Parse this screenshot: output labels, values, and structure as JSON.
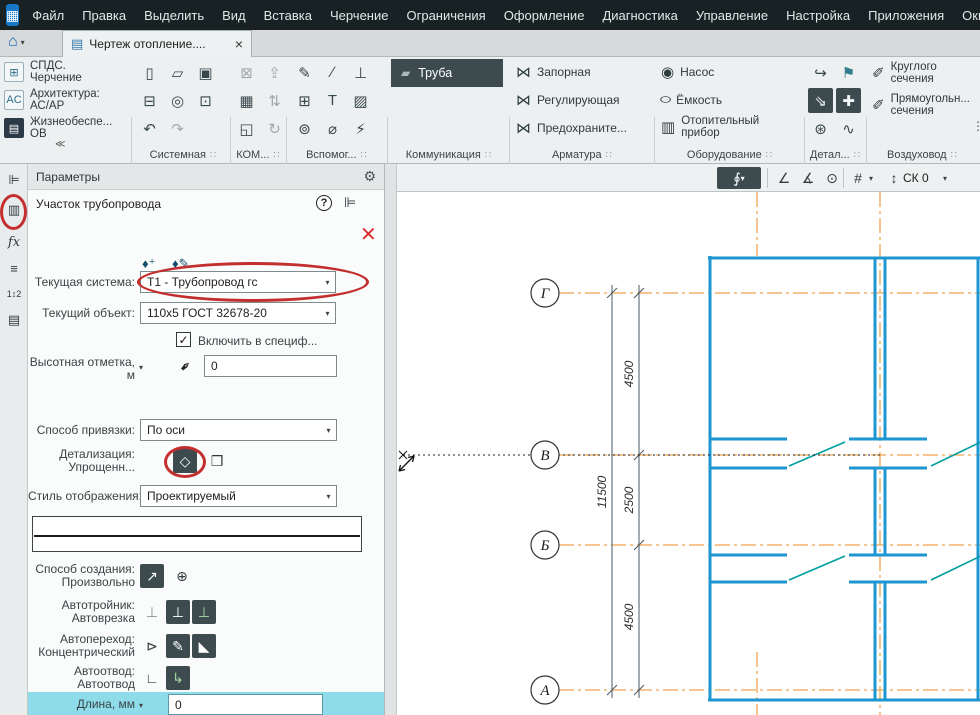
{
  "menubar": {
    "items": [
      "Файл",
      "Правка",
      "Выделить",
      "Вид",
      "Вставка",
      "Черчение",
      "Ограничения",
      "Оформление",
      "Диагностика",
      "Управление",
      "Настройка",
      "Приложения",
      "Окн"
    ]
  },
  "tabbar": {
    "active_tab": "Чертеж отопление...."
  },
  "workspaces": [
    {
      "line1": "СПДС.",
      "line2": "Черчение",
      "icon": "⊞"
    },
    {
      "line1": "Архитектура:",
      "line2": "АС/АР",
      "icon": "AC"
    },
    {
      "line1": "Жизнеобеспе...",
      "line2": "ОВ",
      "icon": "▤"
    }
  ],
  "ribbon": {
    "pipe_button": "Труба",
    "groups": [
      {
        "label": "Системная"
      },
      {
        "label": "КОМ..."
      },
      {
        "label": "Вспомог..."
      },
      {
        "label": "Коммуникация"
      },
      {
        "label": "Арматура"
      },
      {
        "label": "Оборудование"
      },
      {
        "label": "Детал..."
      },
      {
        "label": "Воздуховод"
      }
    ],
    "armature_items": [
      "Запорная",
      "Регулирующая",
      "Предохраните..."
    ],
    "equipment_items": [
      "Насос",
      "Ёмкость",
      "Отопительный прибор"
    ],
    "duct_items": [
      {
        "line1": "Круглого",
        "line2": "сечения"
      },
      {
        "line1": "Прямоугольн...",
        "line2": "сечения"
      }
    ]
  },
  "params": {
    "title": "Параметры",
    "object_title": "Участок трубопровода",
    "current_system_label": "Текущая система:",
    "current_system_value": "Т1 - Трубопровод гс",
    "current_object_label": "Текущий объект:",
    "current_object_value": "110х5 ГОСТ 32678-20",
    "include_in_spec": "Включить в специф...",
    "height_label_1": "Высотная отметка,",
    "height_label_2": "м",
    "height_value": "0",
    "snap_label": "Способ привязки:",
    "snap_value": "По оси",
    "detail_label_1": "Детализация:",
    "detail_label_2": "Упрощенн...",
    "style_label": "Стиль отображения:",
    "style_value": "Проектируемый",
    "create_label_1": "Способ создания:",
    "create_label_2": "Произвольно",
    "autotee_label_1": "Автотройник:",
    "autotee_label_2": "Автоврезка",
    "autotrans_label_1": "Автопереход:",
    "autotrans_label_2": "Концентрический",
    "autobend_label_1": "Автоотвод:",
    "autobend_label_2": "Автоотвод",
    "length_label": "Длина, мм",
    "length_value": "0"
  },
  "canvas_toolbar": {
    "cs_label": "СК 0"
  },
  "drawing": {
    "axes": [
      "Г",
      "В",
      "Б",
      "А"
    ],
    "dim_overall": "11500",
    "dim_segments": [
      "4500",
      "2500",
      "4500"
    ]
  },
  "colors": {
    "wall_blue": "#1e96d2",
    "centerline_orange": "#f0a452",
    "door_teal": "#009e9e",
    "annotation_red": "#c32f2f",
    "accent_dark": "#3d4b4f",
    "length_row_cyan": "#8edbe9"
  },
  "icons": {
    "logo": "▦",
    "home": "⌂",
    "caret": "▾",
    "doc": "▤",
    "close_tab": "×",
    "collapse": "≪",
    "grip": "∷",
    "overflow": "⋮",
    "new_doc": "▯",
    "open_doc": "▱",
    "save": "▣",
    "print": "⊟",
    "preview": "◎",
    "export": "⊡",
    "undo": "↶",
    "redo": "↷",
    "clipboard": "⊠",
    "arrow_up": "⇪",
    "table": "▦",
    "swap": "⇅",
    "image": "◱",
    "refresh": "↻",
    "pencil": "✎",
    "line": "∕",
    "perp": "⊥",
    "ortho": "⊞",
    "text": "T",
    "hatch": "▨",
    "diameter": "⌀",
    "bolt": "⚡",
    "rings": "⊚",
    "pipe": "▰",
    "valve": "⋈",
    "pump": "◉",
    "tank": "○",
    "radiator": "▥",
    "bend_arrow": "↪",
    "flag": "⚑",
    "arrow_se": "⇘",
    "plus": "✚",
    "burst": "⊛",
    "wave": "∿",
    "pen": "✐",
    "tree": "⊫",
    "panel": "▥",
    "fx": "fx",
    "bars": "≡",
    "sort": "1↕2",
    "listbox": "▤",
    "gear": "⚙",
    "help": "?",
    "close_red": "✕",
    "drop_add": "♦⁺",
    "drop_edit": "♦✎",
    "check": "✓",
    "pin": "✒",
    "diamond": "◇",
    "cube": "❒",
    "pipe_diag": "↗",
    "snap_point": "⊕",
    "tee": "⊥",
    "transition": "⊳",
    "corner": "◣",
    "elbow": "∟",
    "elbow_auto": "↳",
    "magnet": "∮",
    "angle": "∠",
    "angle2": "∡",
    "tangent": "⊙",
    "hash": "#",
    "cs": "↕"
  }
}
